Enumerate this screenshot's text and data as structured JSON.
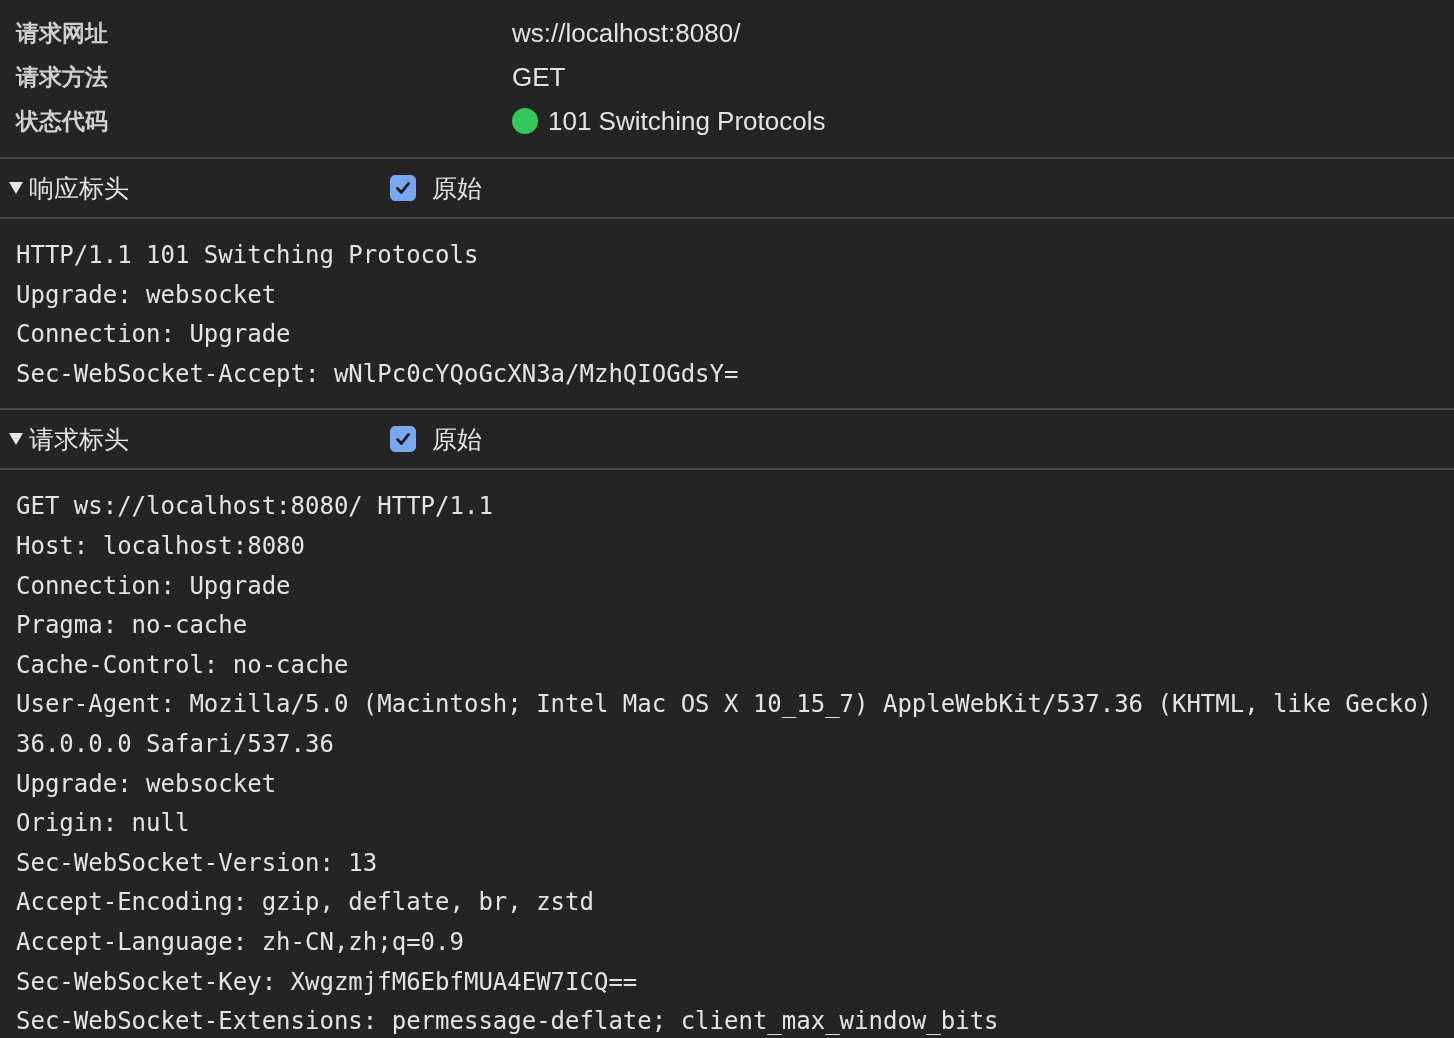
{
  "general": [
    {
      "label": "请求网址",
      "value": "ws://localhost:8080/"
    },
    {
      "label": "请求方法",
      "value": "GET"
    },
    {
      "label": "状态代码",
      "value": "101 Switching Protocols",
      "color": "#34c759"
    }
  ],
  "sections": [
    {
      "title": "响应标头",
      "expanded": true,
      "raw_label": "原始",
      "raw_checked": true,
      "lines": [
        "HTTP/1.1 101 Switching Protocols",
        "Upgrade: websocket",
        "Connection: Upgrade",
        "Sec-WebSocket-Accept: wNlPc0cYQoGcXN3a/MzhQIOGdsY="
      ]
    },
    {
      "title": "请求标头",
      "expanded": true,
      "raw_label": "原始",
      "raw_checked": true,
      "lines": [
        "GET ws://localhost:8080/ HTTP/1.1",
        "Host: localhost:8080",
        "Connection: Upgrade",
        "Pragma: no-cache",
        "Cache-Control: no-cache",
        "User-Agent: Mozilla/5.0 (Macintosh; Intel Mac OS X 10_15_7) AppleWebKit/537.36 (KHTML, like Gecko)",
        "36.0.0.0 Safari/537.36",
        "Upgrade: websocket",
        "Origin: null",
        "Sec-WebSocket-Version: 13",
        "Accept-Encoding: gzip, deflate, br, zstd",
        "Accept-Language: zh-CN,zh;q=0.9",
        "Sec-WebSocket-Key: XwgzmjfM6EbfMUA4EW7ICQ==",
        "Sec-WebSocket-Extensions: permessage-deflate; client_max_window_bits"
      ]
    }
  ]
}
